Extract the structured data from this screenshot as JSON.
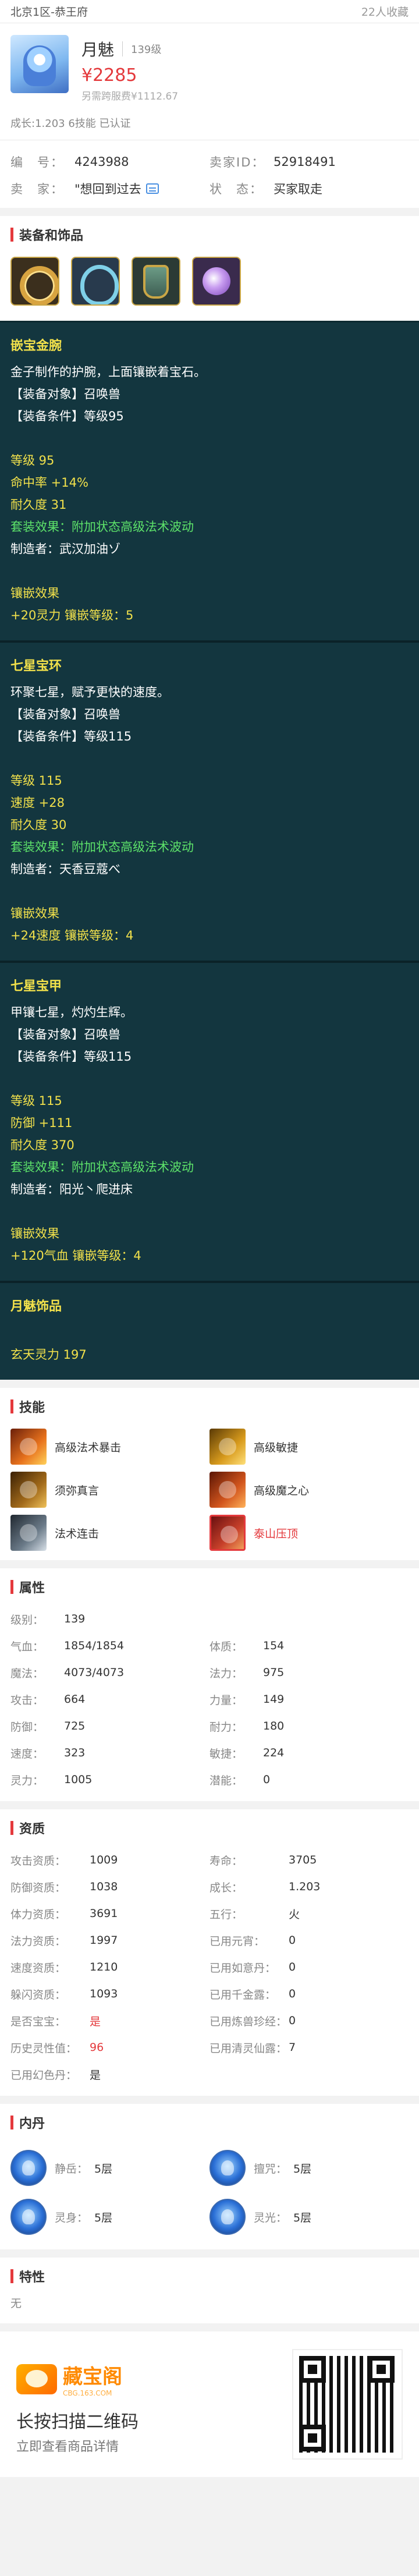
{
  "topbar": {
    "server": "北京1区-恭王府",
    "favorites": "22人收藏"
  },
  "pet": {
    "name": "月魅",
    "level": "139级",
    "price": "¥2285",
    "reference": "另需跨服费¥1112.67",
    "growth": "成长:1.203 6技能 已认证"
  },
  "meta": {
    "id_label": "编　号：",
    "id_value": "4243988",
    "seller_id_label": "卖家ID：",
    "seller_id_value": "52918491",
    "seller_label": "卖　家：",
    "seller_value": "\"想回到过去",
    "status_label": "状　态：",
    "status_value": "买家取走"
  },
  "equip_section": {
    "title": "装备和饰品",
    "icons": [
      "ring-icon",
      "loop-icon",
      "armor-icon",
      "orb-icon"
    ]
  },
  "equipment": [
    {
      "name": "嵌宝金腕",
      "desc": "金子制作的护腕，上面镶嵌着宝石。",
      "target": "【装备对象】召唤兽",
      "condition": "【装备条件】等级95",
      "stats": [
        "等级 95",
        "命中率 +14%"
      ],
      "stats_extra": "耐久度 31",
      "effect": "套装效果：附加状态高级法术波动",
      "maker": "制造者：武汉加油ゾ",
      "inlay_title": "镶嵌效果",
      "inlay": "+20灵力 镶嵌等级：5"
    },
    {
      "name": "七星宝环",
      "desc": "环聚七星，赋予更快的速度。",
      "target": "【装备对象】召唤兽",
      "condition": "【装备条件】等级115",
      "stats": [
        "等级 115",
        "速度 +28"
      ],
      "stats_extra": "耐久度 30",
      "effect": "套装效果：附加状态高级法术波动",
      "maker": "制造者：天香豆蔻べ",
      "inlay_title": "镶嵌效果",
      "inlay": "+24速度 镶嵌等级：4"
    },
    {
      "name": "七星宝甲",
      "desc": "甲镶七星，灼灼生辉。",
      "target": "【装备对象】召唤兽",
      "condition": "【装备条件】等级115",
      "stats": [
        "等级 115",
        "防御 +111"
      ],
      "stats_extra": "耐久度 370",
      "effect": "套装效果：附加状态高级法术波动",
      "maker": "制造者：阳光丶爬进床",
      "inlay_title": "镶嵌效果",
      "inlay": "+120气血 镶嵌等级：4"
    }
  ],
  "accessory": {
    "name": "月魅饰品",
    "value": "玄天灵力 197"
  },
  "skills": {
    "title": "技能",
    "items": [
      {
        "name": "高级法术暴击",
        "icon": "spell-crit-icon"
      },
      {
        "name": "高级敏捷",
        "icon": "agility-icon"
      },
      {
        "name": "须弥真言",
        "icon": "mantra-icon"
      },
      {
        "name": "高级魔之心",
        "icon": "demon-heart-icon"
      },
      {
        "name": "法术连击",
        "icon": "spell-combo-icon"
      },
      {
        "name": "泰山压顶",
        "icon": "mountain-crush-icon"
      }
    ]
  },
  "attributes": {
    "title": "属性",
    "rows": [
      {
        "k": "级别：",
        "v": "139"
      },
      {
        "k": "",
        "v": ""
      },
      {
        "k": "气血：",
        "v": "1854/1854"
      },
      {
        "k": "体质：",
        "v": "154"
      },
      {
        "k": "魔法：",
        "v": "4073/4073"
      },
      {
        "k": "法力：",
        "v": "975"
      },
      {
        "k": "攻击：",
        "v": "664"
      },
      {
        "k": "力量：",
        "v": "149"
      },
      {
        "k": "防御：",
        "v": "725"
      },
      {
        "k": "耐力：",
        "v": "180"
      },
      {
        "k": "速度：",
        "v": "323"
      },
      {
        "k": "敏捷：",
        "v": "224"
      },
      {
        "k": "灵力：",
        "v": "1005"
      },
      {
        "k": "潜能：",
        "v": "0"
      }
    ]
  },
  "aptitude": {
    "title": "资质",
    "rows": [
      {
        "k": "攻击资质：",
        "v": "1009"
      },
      {
        "k": "寿命：",
        "v": "3705"
      },
      {
        "k": "防御资质：",
        "v": "1038"
      },
      {
        "k": "成长：",
        "v": "1.203"
      },
      {
        "k": "体力资质：",
        "v": "3691"
      },
      {
        "k": "五行：",
        "v": "火"
      },
      {
        "k": "法力资质：",
        "v": "1997"
      },
      {
        "k": "已用元宵：",
        "v": "0"
      },
      {
        "k": "速度资质：",
        "v": "1210"
      },
      {
        "k": "已用如意丹：",
        "v": "0"
      },
      {
        "k": "躲闪资质：",
        "v": "1093"
      },
      {
        "k": "已用千金露：",
        "v": "0"
      },
      {
        "k": "是否宝宝：",
        "v": "是"
      },
      {
        "k": "已用炼兽珍经：",
        "v": "0"
      },
      {
        "k": "历史灵性值：",
        "v": "96"
      },
      {
        "k": "已用清灵仙露：",
        "v": "7"
      },
      {
        "k": "已用幻色丹：",
        "v": "是"
      },
      {
        "k": "",
        "v": ""
      }
    ]
  },
  "neidan": {
    "title": "内丹",
    "items": [
      {
        "k": "静岳：",
        "v": "5层",
        "icon": "jingyue-icon"
      },
      {
        "k": "擅咒：",
        "v": "5层",
        "icon": "shanzhou-icon"
      },
      {
        "k": "灵身：",
        "v": "5层",
        "icon": "lingshen-icon"
      },
      {
        "k": "灵光：",
        "v": "5层",
        "icon": "lingguang-icon"
      }
    ]
  },
  "traits": {
    "title": "特性",
    "value": "无"
  },
  "footer": {
    "logo_cn": "藏宝阁",
    "logo_en": "CBG.163.COM",
    "scan_title": "长按扫描二维码",
    "scan_sub": "立即查看商品详情"
  }
}
